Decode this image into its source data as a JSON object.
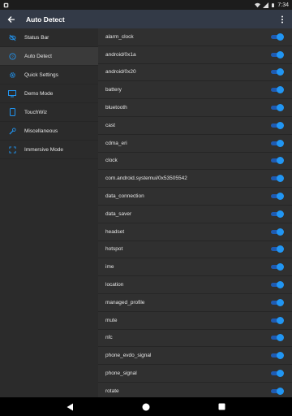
{
  "status_bar": {
    "time": "7:34",
    "icons": [
      "notification-icon",
      "wifi-icon",
      "signal-icon",
      "battery-icon"
    ]
  },
  "app_bar": {
    "title": "Auto Detect",
    "back_icon": "arrow-back-icon",
    "overflow_icon": "more-vert-icon"
  },
  "sidebar": {
    "items": [
      {
        "label": "Status Bar",
        "icon": "eye-off-icon",
        "active": false
      },
      {
        "label": "Auto Detect",
        "icon": "help-circle-icon",
        "active": true
      },
      {
        "label": "Quick Settings",
        "icon": "gear-icon",
        "active": false
      },
      {
        "label": "Demo Mode",
        "icon": "monitor-icon",
        "active": false
      },
      {
        "label": "TouchWiz",
        "icon": "phone-icon",
        "active": false
      },
      {
        "label": "Miscellaneous",
        "icon": "wrench-icon",
        "active": false
      },
      {
        "label": "Immersive Mode",
        "icon": "fullscreen-icon",
        "active": false
      }
    ]
  },
  "list": {
    "items": [
      {
        "label": "alarm_clock",
        "enabled": true
      },
      {
        "label": "android/0x1a",
        "enabled": true
      },
      {
        "label": "android/0x20",
        "enabled": true
      },
      {
        "label": "battery",
        "enabled": true
      },
      {
        "label": "bluetooth",
        "enabled": true
      },
      {
        "label": "cast",
        "enabled": true
      },
      {
        "label": "cdma_eri",
        "enabled": true
      },
      {
        "label": "clock",
        "enabled": true
      },
      {
        "label": "com.android.systemui/0x53505542",
        "enabled": true
      },
      {
        "label": "data_connection",
        "enabled": true
      },
      {
        "label": "data_saver",
        "enabled": true
      },
      {
        "label": "headset",
        "enabled": true
      },
      {
        "label": "hotspot",
        "enabled": true
      },
      {
        "label": "ime",
        "enabled": true
      },
      {
        "label": "location",
        "enabled": true
      },
      {
        "label": "managed_profile",
        "enabled": true
      },
      {
        "label": "mute",
        "enabled": true
      },
      {
        "label": "nfc",
        "enabled": true
      },
      {
        "label": "phone_evdo_signal",
        "enabled": true
      },
      {
        "label": "phone_signal",
        "enabled": true
      },
      {
        "label": "rotate",
        "enabled": true
      }
    ]
  },
  "nav_bar": {
    "buttons": [
      "back-triangle-icon",
      "home-circle-icon",
      "recents-square-icon"
    ]
  },
  "colors": {
    "accent": "#2196f3",
    "app_bar": "#333a47",
    "background": "#303030"
  }
}
